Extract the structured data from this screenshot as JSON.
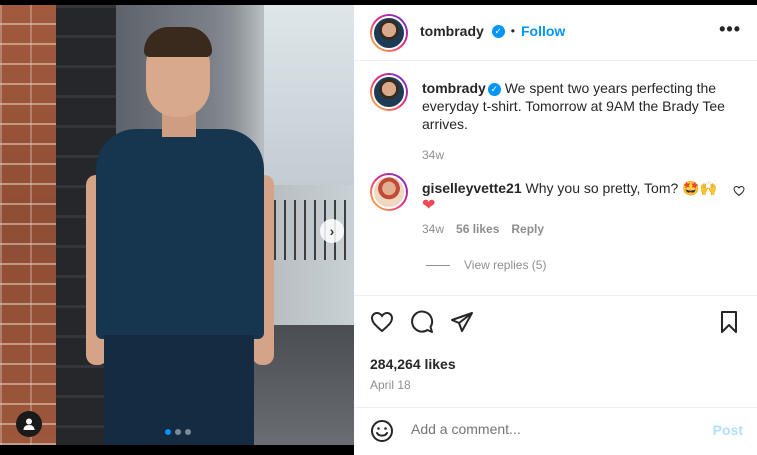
{
  "post": {
    "author": "tombrady",
    "follow_label": "Follow",
    "more_label": "•••",
    "header_separator": "•"
  },
  "caption": {
    "author": "tombrady",
    "text": "We spent two years perfecting the everyday t-shirt. Tomorrow at 9AM the Brady Tee arrives.",
    "age": "34w"
  },
  "comment": {
    "author": "giselleyvette21",
    "text": "Why you so pretty, Tom? 🤩🙌",
    "reaction": "❤",
    "age": "34w",
    "likes": "56 likes",
    "reply_label": "Reply",
    "view_replies": "View replies (5)"
  },
  "stats": {
    "likes": "284,264 likes",
    "date": "April 18"
  },
  "composer": {
    "placeholder": "Add a comment...",
    "post_label": "Post"
  },
  "carousel": {
    "slide_count": 3,
    "active_index": 0,
    "next_icon": "›"
  },
  "colors": {
    "accent": "#0095f6",
    "heart": "#ed4956",
    "muted": "#8e8e8e"
  }
}
